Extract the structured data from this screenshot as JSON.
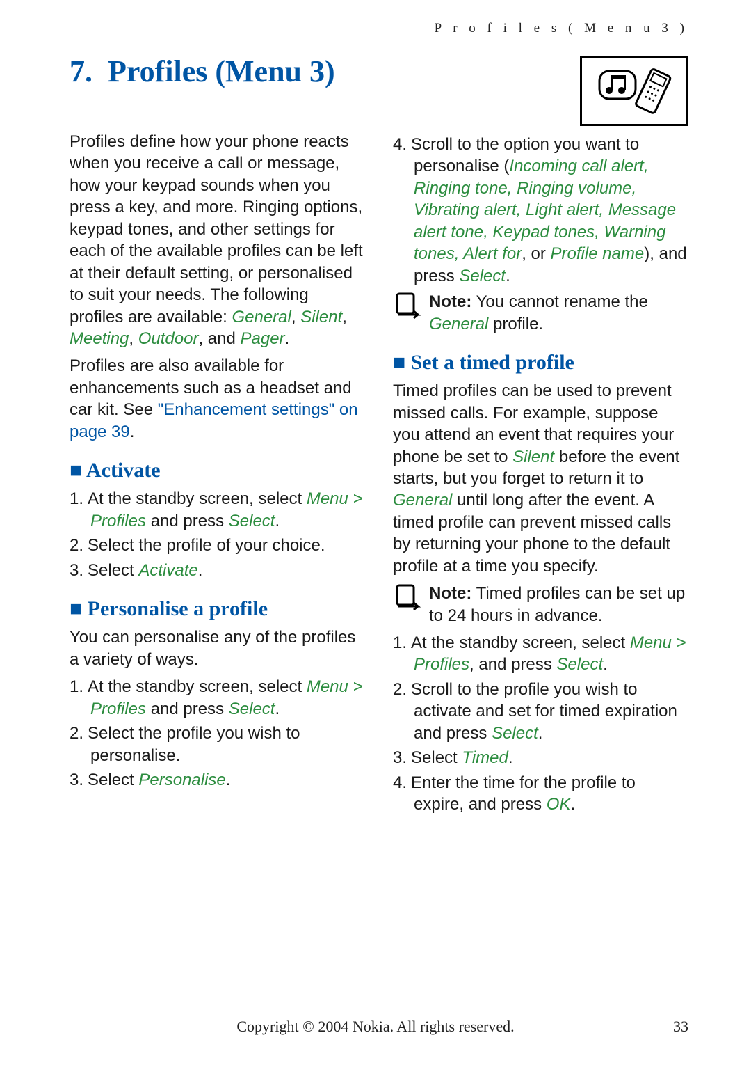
{
  "running_header": "P r o f i l e s   ( M e n u   3 )",
  "chapter": {
    "number": "7.",
    "title": "Profiles (Menu 3)"
  },
  "footer": "Copyright © 2004 Nokia. All rights reserved.",
  "page_number": "33",
  "left": {
    "intro1a": "Profiles define how your phone reacts when you receive a call or message, how your keypad sounds when you press a key, and more. Ringing options, keypad tones, and other settings for each of the available profiles can be left at their default setting, or personalised to suit your needs. The following profiles are available: ",
    "profiles": [
      "General",
      "Silent",
      "Meeting",
      "Outdoor",
      "Pager"
    ],
    "intro2a": "Profiles are also available for enhancements such as a headset and car kit. See ",
    "intro2_link": "\"Enhancement settings\" on page 39",
    "activate_title": "Activate",
    "act_1a": "At the standby screen, select ",
    "act_1_menu": "Menu",
    "act_1_gt": " > ",
    "act_1_prof": "Profiles",
    "act_1_mid": " and press ",
    "act_1_sel": "Select",
    "act_2": "Select the profile of your choice.",
    "act_3a": "Select ",
    "act_3_link": "Activate",
    "pers_title": "Personalise a profile",
    "pers_intro": "You can personalise any of the profiles a variety of ways.",
    "pers_1a": "At the standby screen, select ",
    "pers_1_menu": "Menu",
    "pers_1_gt": " > ",
    "pers_1_prof": "Profiles",
    "pers_1_mid": " and press ",
    "pers_1_sel": "Select",
    "pers_2": "Select the profile you wish to personalise.",
    "pers_3a": "Select ",
    "pers_3_link": "Personalise"
  },
  "right": {
    "step4a": "Scroll to the option you want to personalise (",
    "step4_opts": "Incoming call alert, Ringing tone, Ringing volume, Vibrating alert, Light alert, Message alert tone, Keypad tones, Warning tones, Alert for",
    "step4_mid1": ", or ",
    "step4_prof": "Profile name",
    "step4_mid2": "), and press ",
    "step4_sel": "Select",
    "note1_label": "Note:",
    "note1a": " You cannot rename the ",
    "note1_gen": "General",
    "note1b": " profile.",
    "timed_title": "Set a timed profile",
    "timed_p1a": "Timed profiles can be used to prevent missed calls. For example, suppose you attend an event that requires your phone be set to ",
    "timed_p1_silent": "Silent",
    "timed_p1b": " before the event starts, but you forget to return it to ",
    "timed_p1_general": "General",
    "timed_p1c": " until long after the event. A timed profile can prevent missed calls by returning your phone to the default profile at a time you specify.",
    "note2_label": "Note:",
    "note2": " Timed profiles can be set up to 24 hours in advance.",
    "t1a": "At the standby screen, select ",
    "t1_menu": "Menu",
    "t1_gt": " > ",
    "t1_prof": "Profiles",
    "t1_mid": ", and press ",
    "t1_sel": "Select",
    "t2a": "Scroll to the profile you wish to activate and set for timed expiration and press ",
    "t2_sel": "Select",
    "t3a": "Select ",
    "t3_timed": "Timed",
    "t4a": "Enter the time for the profile to expire, and press ",
    "t4_ok": "OK"
  }
}
